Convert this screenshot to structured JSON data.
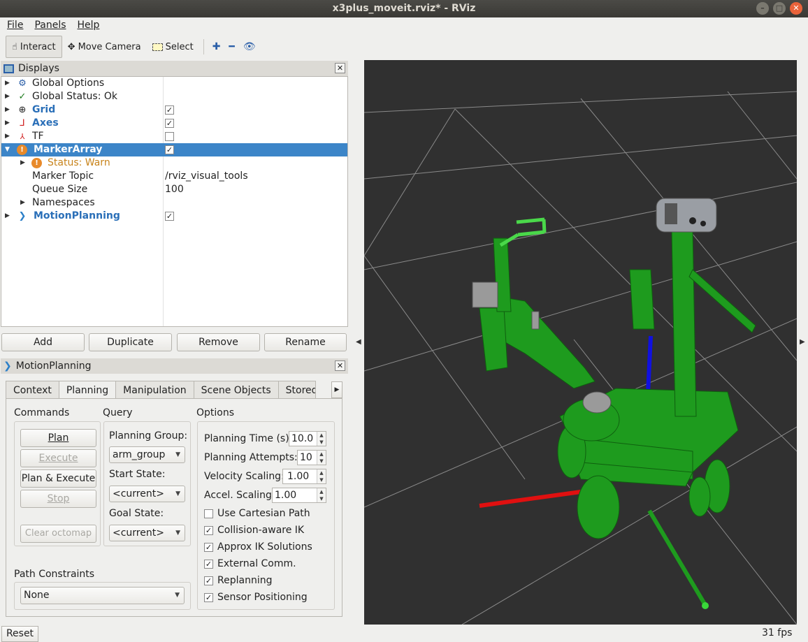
{
  "window": {
    "title": "x3plus_moveit.rviz* - RViz"
  },
  "menu": [
    "File",
    "Panels",
    "Help"
  ],
  "toolbar": {
    "interact": "Interact",
    "move_camera": "Move Camera",
    "select": "Select"
  },
  "displays": {
    "title": "Displays",
    "items": [
      {
        "label": "Global Options"
      },
      {
        "label": "Global Status: Ok"
      },
      {
        "label": "Grid",
        "checked": true
      },
      {
        "label": "Axes",
        "checked": true
      },
      {
        "label": "TF",
        "checked": false
      },
      {
        "label": "MarkerArray",
        "checked": true
      },
      {
        "label": "Status: Warn"
      },
      {
        "label": "Marker Topic",
        "value": "/rviz_visual_tools"
      },
      {
        "label": "Queue Size",
        "value": "100"
      },
      {
        "label": "Namespaces"
      },
      {
        "label": "MotionPlanning",
        "checked": true
      }
    ],
    "buttons": {
      "add": "Add",
      "duplicate": "Duplicate",
      "remove": "Remove",
      "rename": "Rename"
    }
  },
  "motion_planning": {
    "title": "MotionPlanning",
    "tabs": [
      "Context",
      "Planning",
      "Manipulation",
      "Scene Objects",
      "Stored"
    ],
    "active_tab": "Planning",
    "commands": {
      "label": "Commands",
      "plan": "Plan",
      "execute": "Execute",
      "plan_execute": "Plan & Execute",
      "stop": "Stop",
      "clear_octomap": "Clear octomap"
    },
    "query": {
      "label": "Query",
      "planning_group_label": "Planning Group:",
      "planning_group": "arm_group",
      "start_state_label": "Start State:",
      "start_state": "<current>",
      "goal_state_label": "Goal State:",
      "goal_state": "<current>"
    },
    "options": {
      "label": "Options",
      "planning_time_label": "Planning Time (s):",
      "planning_time": "10.0",
      "planning_attempts_label": "Planning Attempts:",
      "planning_attempts": "10",
      "velocity_scaling_label": "Velocity Scaling:",
      "velocity_scaling": "1.00",
      "accel_scaling_label": "Accel. Scaling:",
      "accel_scaling": "1.00",
      "checkboxes": [
        {
          "label": "Use Cartesian Path",
          "checked": false
        },
        {
          "label": "Collision-aware IK",
          "checked": true
        },
        {
          "label": "Approx IK Solutions",
          "checked": true
        },
        {
          "label": "External Comm.",
          "checked": true
        },
        {
          "label": "Replanning",
          "checked": true
        },
        {
          "label": "Sensor Positioning",
          "checked": true
        }
      ]
    },
    "path_constraints": {
      "label": "Path Constraints",
      "value": "None"
    }
  },
  "status": {
    "reset": "Reset",
    "fps": "31 fps"
  },
  "colors": {
    "selection": "#3c85c8",
    "robot": "#1e9b1e",
    "x_axis": "#e01010",
    "z_axis": "#1010e0",
    "viewport_bg": "#303030"
  }
}
